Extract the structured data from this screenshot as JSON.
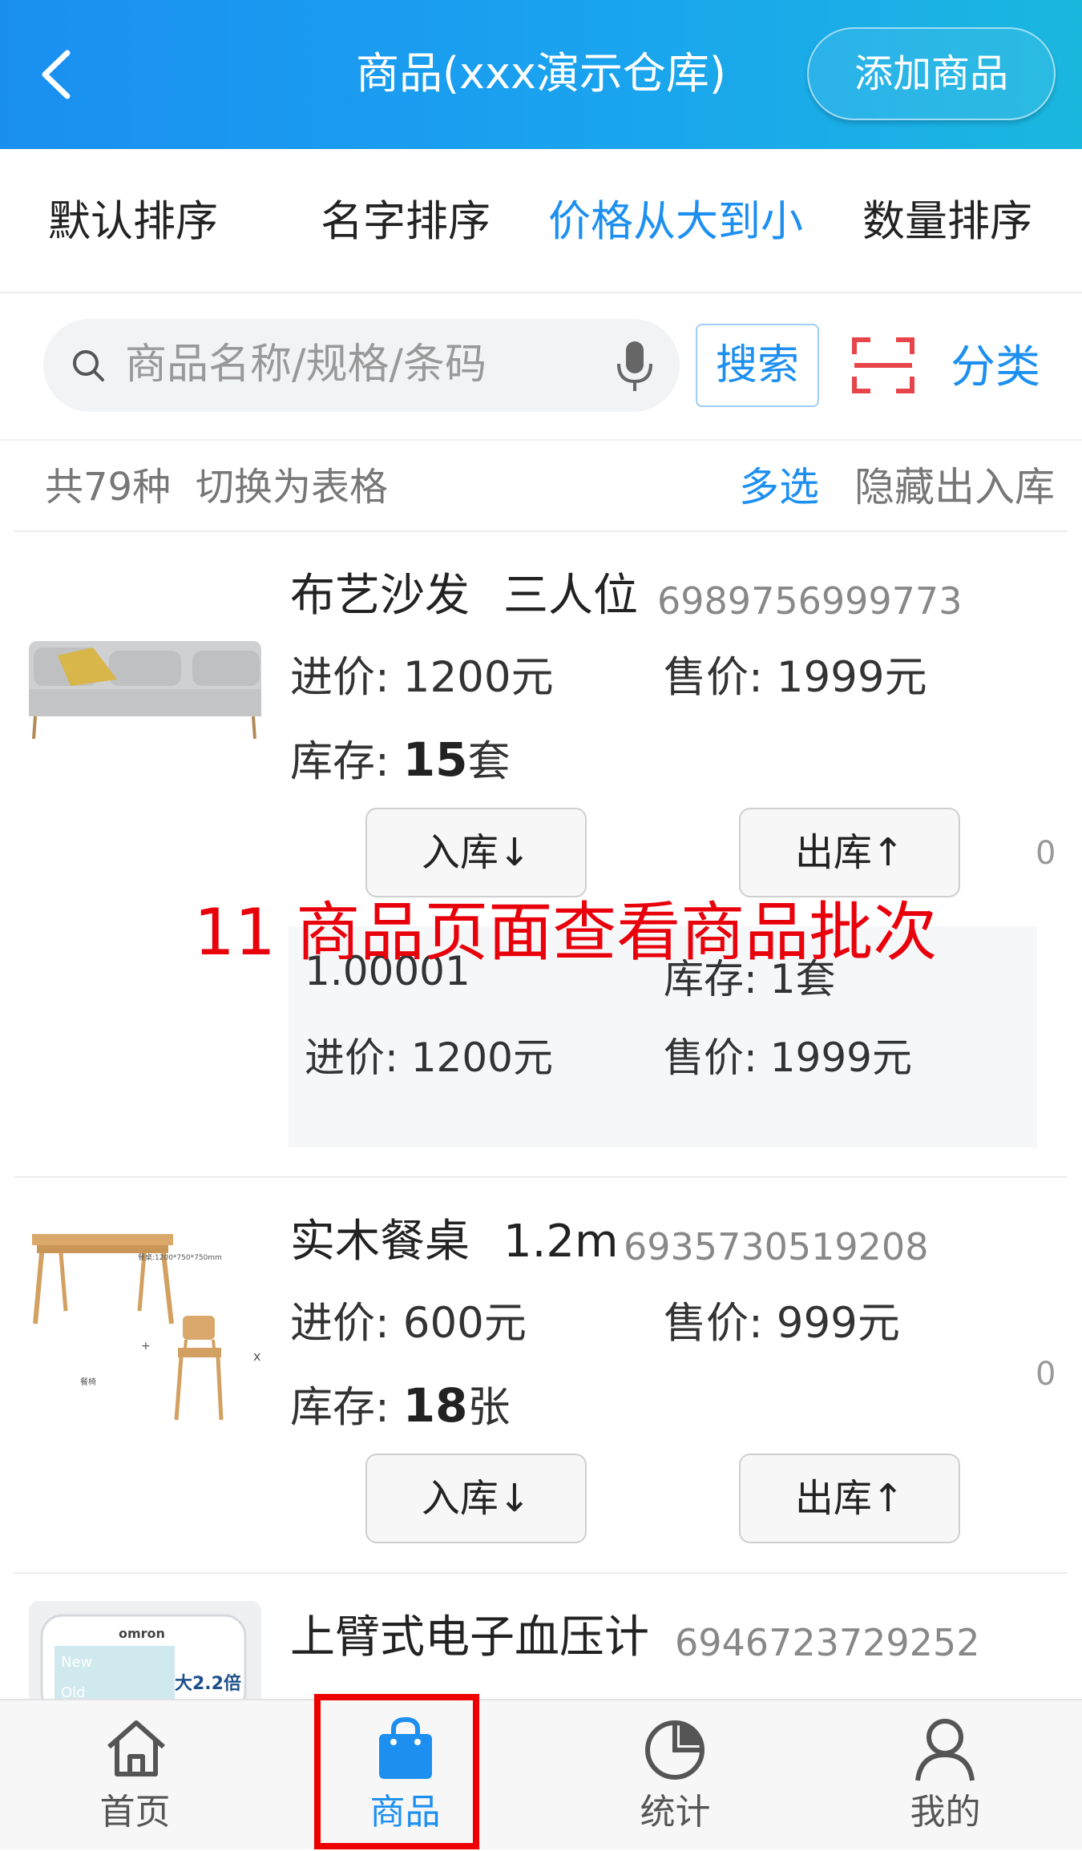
{
  "header": {
    "title": "商品(xxx演示仓库)",
    "add_label": "添加商品"
  },
  "sort": {
    "items": [
      "默认排序",
      "名字排序",
      "价格从大到小",
      "数量排序"
    ],
    "active_index": 2
  },
  "search": {
    "placeholder": "商品名称/规格/条码",
    "button": "搜索",
    "category": "分类"
  },
  "summary": {
    "count": "共79种",
    "switch": "切换为表格",
    "multi": "多选",
    "hide": "隐藏出入库"
  },
  "products": [
    {
      "name": "布艺沙发",
      "spec": "三人位",
      "code": "6989756999773",
      "cost_label": "进价:",
      "cost": "1200元",
      "price_label": "售价:",
      "price": "1999元",
      "stock_label": "库存:",
      "stock_qty": "15",
      "stock_unit": "套",
      "badge": "0"
    },
    {
      "name": "实木餐桌",
      "spec": "1.2m",
      "code": "6935730519208",
      "cost_label": "进价:",
      "cost": "600元",
      "price_label": "售价:",
      "price": "999元",
      "stock_label": "库存:",
      "stock_qty": "18",
      "stock_unit": "张",
      "badge": "0",
      "image_caption_1": "餐桌:1200*750*750mm",
      "image_caption_2": "餐椅"
    },
    {
      "name": "上臂式电子血压计",
      "code": "6946723729252",
      "image_brand": "omron",
      "image_text_new": "New",
      "image_text_old": "Old",
      "image_text_ratio": "大2.2倍"
    }
  ],
  "buttons": {
    "in": "入库↓",
    "out": "出库↑"
  },
  "batch": {
    "id": "1.00001",
    "stock": "库存: 1套",
    "cost": "进价: 1200元",
    "price": "售价: 1999元"
  },
  "overlay": "11 商品页面查看商品批次",
  "tabs": [
    {
      "label": "首页",
      "icon": "home-icon"
    },
    {
      "label": "商品",
      "icon": "bag-icon"
    },
    {
      "label": "统计",
      "icon": "pie-chart-icon"
    },
    {
      "label": "我的",
      "icon": "user-icon"
    }
  ],
  "colors": {
    "accent": "#1c8ff0",
    "annotation": "#e8000b"
  }
}
